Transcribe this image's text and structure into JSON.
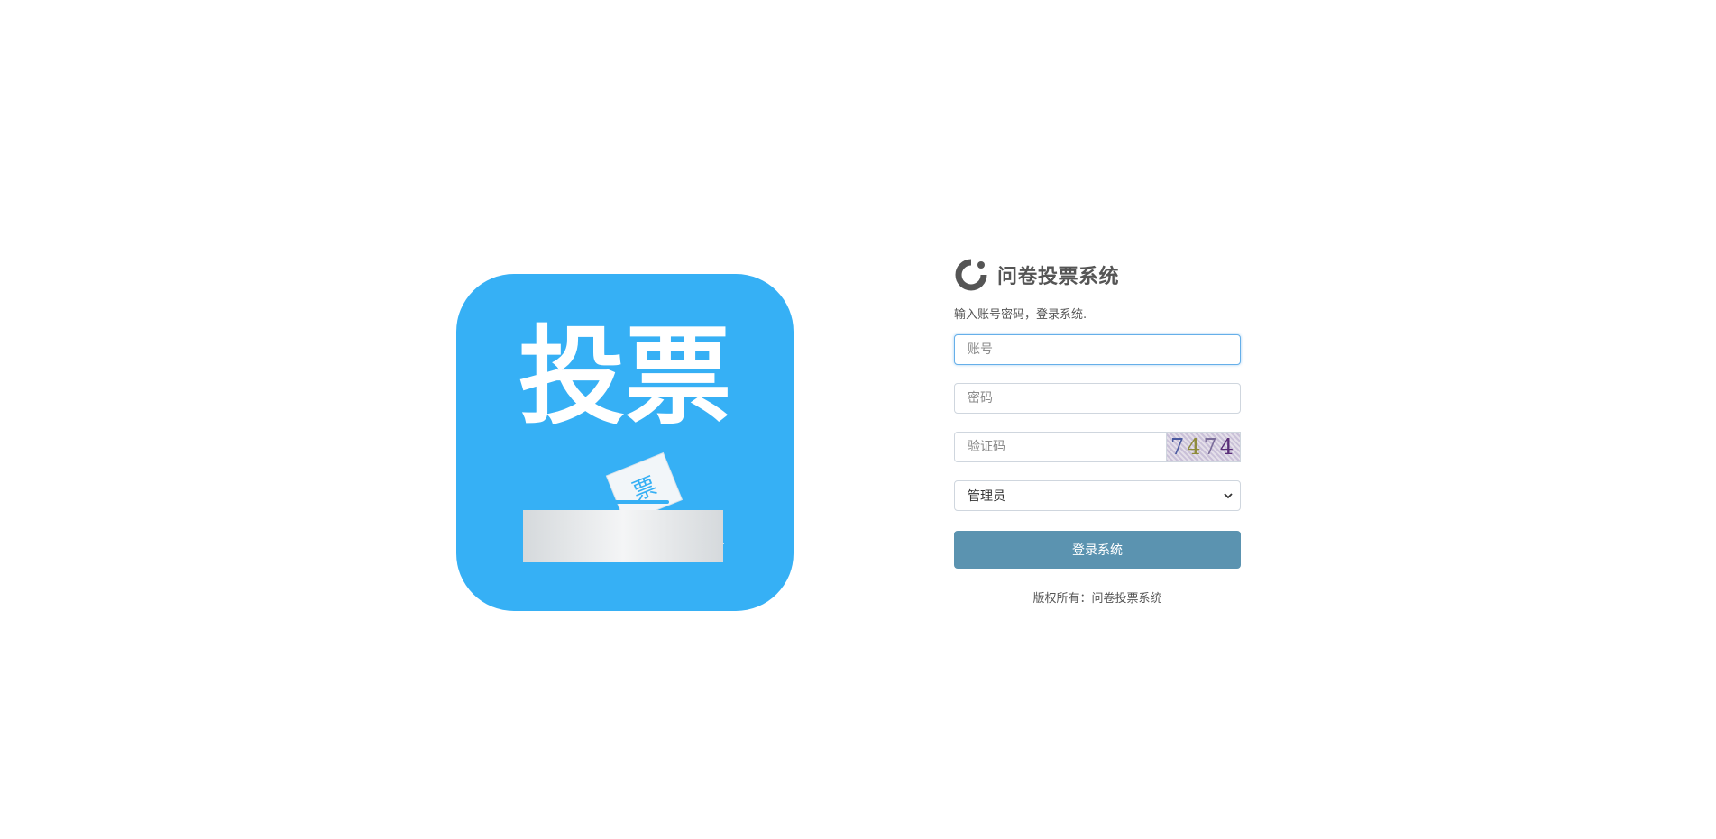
{
  "illustration": {
    "title_text": "投票",
    "ballot_text": "票",
    "background_color": "#36b0f5"
  },
  "brand": {
    "icon": "loading-ring-logo-icon",
    "title": "问卷投票系统"
  },
  "subtitle": "输入账号密码，登录系统.",
  "form": {
    "username_placeholder": "账号",
    "password_placeholder": "密码",
    "captcha_placeholder": "验证码",
    "captcha_digits": [
      "7",
      "4",
      "7",
      "4"
    ],
    "role_selected": "管理员",
    "submit_label": "登录系统"
  },
  "footer": {
    "copyright": "版权所有：问卷投票系统"
  },
  "colors": {
    "primary_button": "#5b93b0",
    "focus_border": "#66afe9",
    "text": "#555555"
  }
}
